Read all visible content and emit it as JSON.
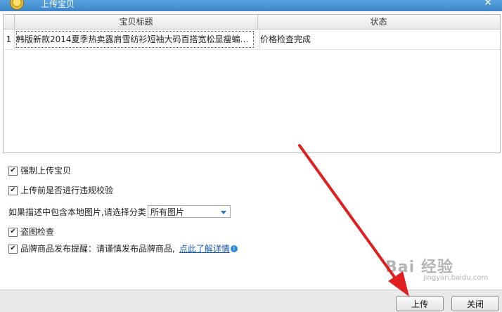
{
  "window": {
    "title": "上传宝贝"
  },
  "grid": {
    "columns": [
      "宝贝标题",
      "状态"
    ],
    "rows": [
      {
        "num": "1",
        "title": "韩版新款2014夏季热卖露肩雪纺衫短袖大码百搭宽松显瘦蝙蝠...",
        "status": "价格检查完成"
      }
    ]
  },
  "options": {
    "force_upload": {
      "label": "强制上传宝贝",
      "checked": true
    },
    "violation_check": {
      "label": "上传前是否进行违规校验",
      "checked": true
    },
    "local_image": {
      "label": "如果描述中包含本地图片,请选择分类",
      "selected": "所有图片"
    },
    "image_theft": {
      "label": "盗图检查",
      "checked": true
    },
    "brand_notice": {
      "label": "品牌商品发布提醒：请谨慎发布品牌商品,",
      "link": "点此了解详情",
      "checked": true
    }
  },
  "footer": {
    "upload_label": "上传",
    "close_label": "关闭"
  },
  "watermark": {
    "main": "Bai 经验",
    "sub": "jingyan.baidu.com"
  },
  "colors": {
    "titlebar": "#3c86c9",
    "annotation_arrow": "#e02020",
    "link": "#1a57b0"
  }
}
